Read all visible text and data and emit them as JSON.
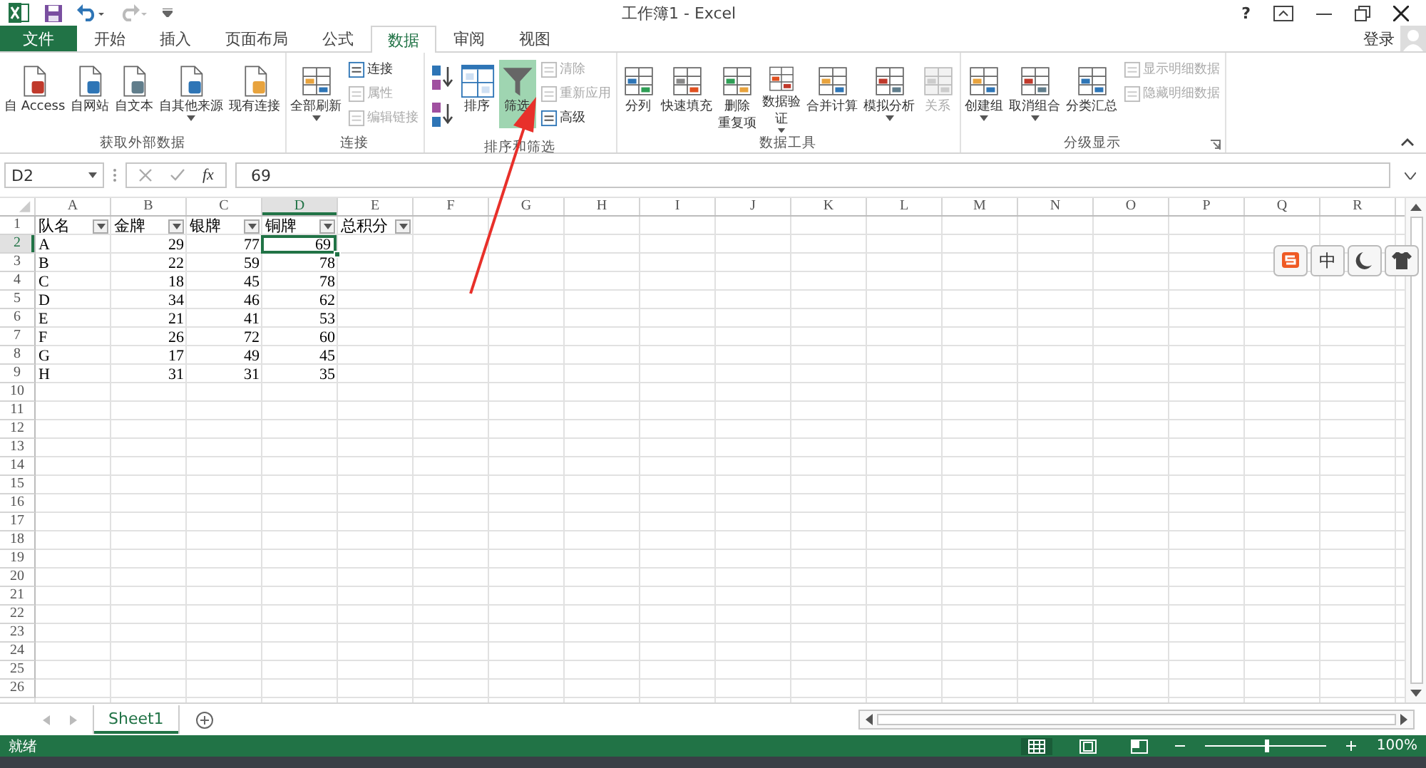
{
  "title_bar": {
    "title": "工作簿1 - Excel",
    "help": "?",
    "account": "登录"
  },
  "tabs": [
    {
      "label": "文件",
      "kind": "file",
      "selected": false
    },
    {
      "label": "开始",
      "kind": "tab",
      "selected": false
    },
    {
      "label": "插入",
      "kind": "tab",
      "selected": false
    },
    {
      "label": "页面布局",
      "kind": "tab",
      "selected": false
    },
    {
      "label": "公式",
      "kind": "tab",
      "selected": false
    },
    {
      "label": "数据",
      "kind": "tab",
      "selected": true
    },
    {
      "label": "审阅",
      "kind": "tab",
      "selected": false
    },
    {
      "label": "视图",
      "kind": "tab",
      "selected": false
    }
  ],
  "ribbon": [
    {
      "label": "获取外部数据",
      "items": [
        {
          "label": "自 Access",
          "kind": "large",
          "disabled": false,
          "selected": false,
          "dropdown": false
        },
        {
          "label": "自网站",
          "kind": "large",
          "disabled": false,
          "selected": false,
          "dropdown": false
        },
        {
          "label": "自文本",
          "kind": "large",
          "disabled": false,
          "selected": false,
          "dropdown": false
        },
        {
          "label": "自其他来源",
          "kind": "large",
          "disabled": false,
          "selected": false,
          "dropdown": true
        },
        {
          "label": "现有连接",
          "kind": "large",
          "disabled": false,
          "selected": false,
          "dropdown": false
        }
      ]
    },
    {
      "label": "连接",
      "items": [
        {
          "label": "全部刷新",
          "kind": "large",
          "disabled": false,
          "selected": false,
          "dropdown": true
        },
        {
          "label": "连接",
          "kind": "small",
          "disabled": false,
          "selected": false,
          "dropdown": false
        },
        {
          "label": "属性",
          "kind": "small",
          "disabled": true,
          "selected": false,
          "dropdown": false
        },
        {
          "label": "编辑链接",
          "kind": "small",
          "disabled": true,
          "selected": false,
          "dropdown": false
        }
      ]
    },
    {
      "label": "排序和筛选",
      "items": [
        {
          "kind": "sort",
          "disabled": false,
          "selected": false,
          "dropdown": false
        },
        {
          "kind": "sort",
          "disabled": false,
          "selected": false,
          "dropdown": false
        },
        {
          "label": "排序",
          "kind": "large",
          "disabled": false,
          "selected": false,
          "dropdown": false
        },
        {
          "label": "筛选",
          "kind": "large",
          "disabled": false,
          "selected": true,
          "dropdown": false
        },
        {
          "label": "清除",
          "kind": "small",
          "disabled": true,
          "selected": false,
          "dropdown": false
        },
        {
          "label": "重新应用",
          "kind": "small",
          "disabled": true,
          "selected": false,
          "dropdown": false
        },
        {
          "label": "高级",
          "kind": "small",
          "disabled": false,
          "selected": false,
          "dropdown": false
        }
      ]
    },
    {
      "label": "数据工具",
      "items": [
        {
          "label": "分列",
          "kind": "large",
          "disabled": false,
          "selected": false,
          "dropdown": false
        },
        {
          "label": "快速填充",
          "kind": "large",
          "disabled": false,
          "selected": false,
          "dropdown": false
        },
        {
          "label_lines": [
            "删除",
            "重复项"
          ],
          "kind": "large",
          "disabled": false,
          "selected": false,
          "dropdown": false
        },
        {
          "label_lines": [
            "数据验",
            "证"
          ],
          "kind": "large",
          "disabled": false,
          "selected": false,
          "dropdown": true
        },
        {
          "label": "合并计算",
          "kind": "large",
          "disabled": false,
          "selected": false,
          "dropdown": false
        },
        {
          "label": "模拟分析",
          "kind": "large",
          "disabled": false,
          "selected": false,
          "dropdown": true
        },
        {
          "label": "关系",
          "kind": "large",
          "disabled": true,
          "selected": false,
          "dropdown": false
        }
      ]
    },
    {
      "label": "分级显示",
      "items": [
        {
          "label": "创建组",
          "kind": "large",
          "disabled": false,
          "selected": false,
          "dropdown": true
        },
        {
          "label": "取消组合",
          "kind": "large",
          "disabled": false,
          "selected": false,
          "dropdown": true
        },
        {
          "label": "分类汇总",
          "kind": "large",
          "disabled": false,
          "selected": false,
          "dropdown": false
        },
        {
          "label": "显示明细数据",
          "kind": "small",
          "disabled": true,
          "selected": false,
          "dropdown": false
        },
        {
          "label": "隐藏明细数据",
          "kind": "small",
          "disabled": true,
          "selected": false,
          "dropdown": false
        }
      ]
    }
  ],
  "formula_bar": {
    "name_box": "D2",
    "function_label": "fx",
    "value": "69"
  },
  "columns": [
    {
      "label": "A",
      "selected": false
    },
    {
      "label": "B",
      "selected": false
    },
    {
      "label": "C",
      "selected": false
    },
    {
      "label": "D",
      "selected": true
    },
    {
      "label": "E",
      "selected": false
    },
    {
      "label": "F",
      "selected": false
    },
    {
      "label": "G",
      "selected": false
    },
    {
      "label": "H",
      "selected": false
    },
    {
      "label": "I",
      "selected": false
    },
    {
      "label": "J",
      "selected": false
    },
    {
      "label": "K",
      "selected": false
    },
    {
      "label": "L",
      "selected": false
    },
    {
      "label": "M",
      "selected": false
    },
    {
      "label": "N",
      "selected": false
    },
    {
      "label": "O",
      "selected": false
    },
    {
      "label": "P",
      "selected": false
    },
    {
      "label": "Q",
      "selected": false
    },
    {
      "label": "R",
      "selected": false
    }
  ],
  "header_row": {
    "number": "1",
    "selected": false,
    "cells": [
      {
        "text": "队名",
        "filter": true
      },
      {
        "text": "金牌",
        "filter": true
      },
      {
        "text": "银牌",
        "filter": true
      },
      {
        "text": "铜牌",
        "filter": true
      },
      {
        "text": "总积分",
        "filter": true
      }
    ]
  },
  "rows": [
    {
      "number": "2",
      "selected": true,
      "cells": [
        "A",
        "29",
        "77",
        "69"
      ]
    },
    {
      "number": "3",
      "selected": false,
      "cells": [
        "B",
        "22",
        "59",
        "78"
      ]
    },
    {
      "number": "4",
      "selected": false,
      "cells": [
        "C",
        "18",
        "45",
        "78"
      ]
    },
    {
      "number": "5",
      "selected": false,
      "cells": [
        "D",
        "34",
        "46",
        "62"
      ]
    },
    {
      "number": "6",
      "selected": false,
      "cells": [
        "E",
        "21",
        "41",
        "53"
      ]
    },
    {
      "number": "7",
      "selected": false,
      "cells": [
        "F",
        "26",
        "72",
        "60"
      ]
    },
    {
      "number": "8",
      "selected": false,
      "cells": [
        "G",
        "17",
        "49",
        "45"
      ]
    },
    {
      "number": "9",
      "selected": false,
      "cells": [
        "H",
        "31",
        "31",
        "35"
      ]
    },
    {
      "number": "10",
      "selected": false
    },
    {
      "number": "11",
      "selected": false
    },
    {
      "number": "12",
      "selected": false
    },
    {
      "number": "13",
      "selected": false
    },
    {
      "number": "14",
      "selected": false
    },
    {
      "number": "15",
      "selected": false
    },
    {
      "number": "16",
      "selected": false
    },
    {
      "number": "17",
      "selected": false
    },
    {
      "number": "18",
      "selected": false
    },
    {
      "number": "19",
      "selected": false
    },
    {
      "number": "20",
      "selected": false
    },
    {
      "number": "21",
      "selected": false
    },
    {
      "number": "22",
      "selected": false
    },
    {
      "number": "23",
      "selected": false
    },
    {
      "number": "24",
      "selected": false
    },
    {
      "number": "25",
      "selected": false
    },
    {
      "number": "26",
      "selected": false
    }
  ],
  "ime_toolbar": {
    "mode": "中"
  },
  "sheet_tabs": [
    {
      "label": "Sheet1",
      "selected": true
    }
  ],
  "status_bar": {
    "status": "就绪",
    "zoom": {
      "level": 0.5,
      "reading": "100%"
    },
    "views": [
      {
        "kind": "normal",
        "selected": true
      },
      {
        "kind": "layout",
        "selected": false
      },
      {
        "kind": "pagebreak",
        "selected": false
      }
    ]
  }
}
